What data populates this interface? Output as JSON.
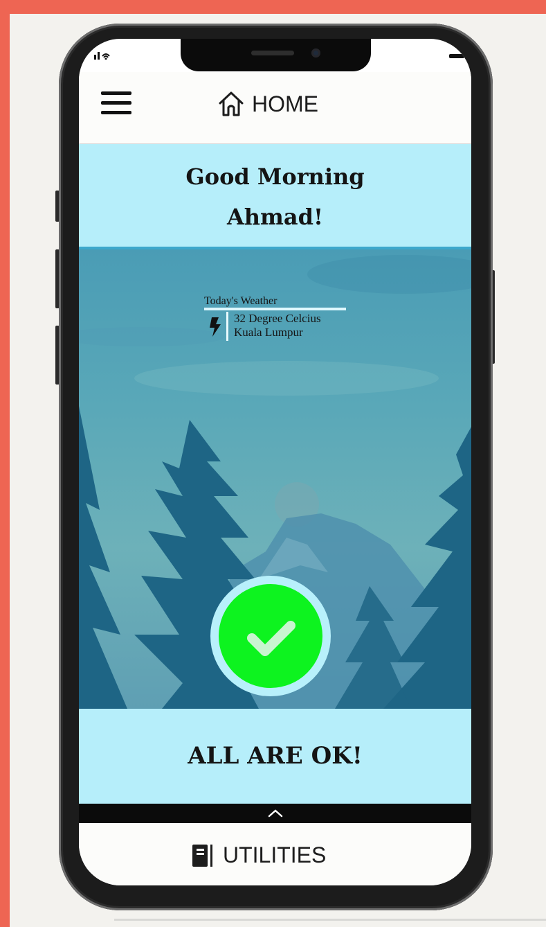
{
  "header": {
    "title": "HOME"
  },
  "greeting": {
    "line1": "Good Morning",
    "line2": "Ahmad!"
  },
  "weather": {
    "title": "Today's Weather",
    "temperature": "32 Degree Celcius",
    "location": "Kuala Lumpur"
  },
  "status": {
    "message": "ALL ARE OK!"
  },
  "footer": {
    "label": "UTILITIES"
  },
  "colors": {
    "accent_frame": "#ee6553",
    "panel_background": "#b6eefa",
    "check_green": "#0df31f"
  }
}
